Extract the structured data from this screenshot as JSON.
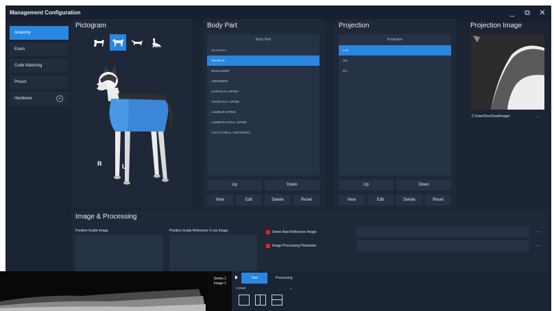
{
  "window": {
    "title": "Management Configuration",
    "controls": {
      "minimize": "_",
      "restore": "⧉",
      "close": "✕"
    }
  },
  "sidebar": {
    "items": [
      {
        "label": "Anatomy",
        "active": true
      },
      {
        "label": "Exam",
        "active": false
      },
      {
        "label": "Code Matching",
        "active": false
      },
      {
        "label": "Preset",
        "active": false
      },
      {
        "label": "Hardware",
        "active": false,
        "icon": "plus-circle-icon"
      }
    ]
  },
  "pictogram": {
    "title": "Pictogram",
    "icons": [
      "horse-icon",
      "dog-icon",
      "cat-icon",
      "bird-icon"
    ],
    "selected_icon": 1,
    "right_label": "R",
    "left_label": "L"
  },
  "body_part": {
    "title": "Body Part",
    "header": "Body Part",
    "rows": [
      "SCAPULA",
      "THORAX",
      "SHOULDER",
      "ABDOMEN",
      "CERVICAL SPINE",
      "THORACIC SPINE",
      "LUMBAR SPINE",
      "LUMBOSACRAL SPINE",
      "COCCYGEAL VERTEBRA"
    ],
    "selected_index": 1,
    "buttons": {
      "up": "Up",
      "down": "Down",
      "new": "New",
      "edit": "Edit",
      "delete": "Delete",
      "reset": "Reset"
    }
  },
  "projection": {
    "title": "Projection",
    "header": "Projection",
    "rows": [
      "LAT",
      "VD",
      "DV"
    ],
    "selected_index": 0,
    "buttons": {
      "up": "Up",
      "down": "Down",
      "new": "New",
      "edit": "Edit",
      "delete": "Delete",
      "reset": "Reset"
    }
  },
  "projection_image": {
    "title": "Projection Image",
    "path": "C:\\User\\Doc\\Dust\\Image\\",
    "browse_label": "…"
  },
  "processing": {
    "title": "Image & Processing",
    "position_guide_image": "Position Guide Image",
    "position_guide_ref": "Position Guide Reference X-ray Image",
    "params": [
      {
        "label": "Demo Raw Reference Image",
        "browse": "…"
      },
      {
        "label": "Image Processing Parameter",
        "browse": "…"
      }
    ]
  },
  "viewer": {
    "series": "Series 1",
    "image": "Image 1"
  },
  "controls": {
    "tabs": [
      {
        "label": "Tool",
        "active": true
      },
      {
        "label": "Processing",
        "active": false
      }
    ],
    "dropdown_value": "Crystal",
    "layouts": [
      "layout-single-icon",
      "layout-split-vertical-icon",
      "layout-split-horizontal-icon"
    ]
  },
  "colors": {
    "accent": "#2a87e0",
    "window_bg": "#1b2433",
    "panel_bg": "#1e2838",
    "field_bg": "#263246",
    "indicator": "#e62020"
  }
}
